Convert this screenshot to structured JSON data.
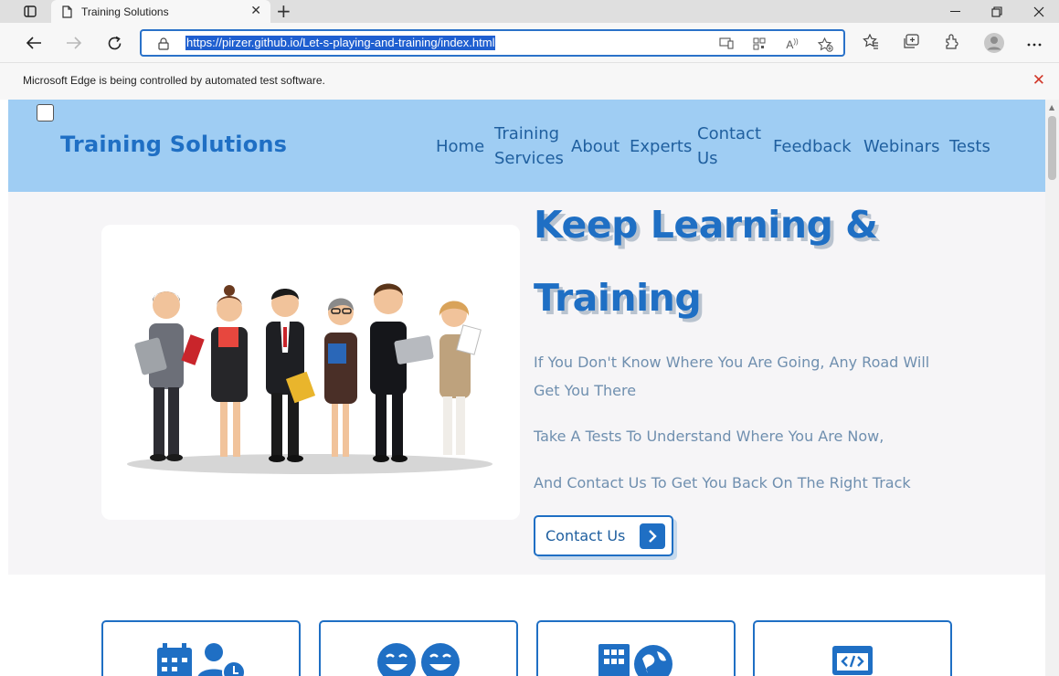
{
  "browser": {
    "tab_title": "Training Solutions",
    "url": "https://pirzer.github.io/Let-s-playing-and-training/index.html",
    "infobar_message": "Microsoft Edge is being controlled by automated test software.",
    "accent_color": "#2a72c9"
  },
  "site": {
    "logo": "Training Solutions",
    "nav": {
      "home": "Home",
      "training_1": "Training",
      "training_2": "Services",
      "about": "About",
      "experts": "Experts",
      "contact_1": "Contact",
      "contact_2": "Us",
      "feedback": "Feedback",
      "webinars": "Webinars",
      "tests": "Tests"
    },
    "hero": {
      "title_line1": "Keep Learning &",
      "title_line2": "Training",
      "text1": "If You Don't Know Where You Are Going, Any Road Will Get You There",
      "text2": "Take A Tests To Understand Where You Are Now,",
      "text3": "And Contact Us To Get You Back On The Right Track",
      "cta": "Contact Us"
    },
    "colors": {
      "header_bg": "#9fcdf3",
      "primary": "#1f6fc4",
      "hero_bg": "#f6f5f7",
      "muted_text": "#6f8faf"
    },
    "features": [
      {
        "icon": "calendar-user-clock-icon"
      },
      {
        "icon": "laughing-faces-icon"
      },
      {
        "icon": "building-globe-icon"
      },
      {
        "icon": "code-window-icon"
      }
    ]
  }
}
